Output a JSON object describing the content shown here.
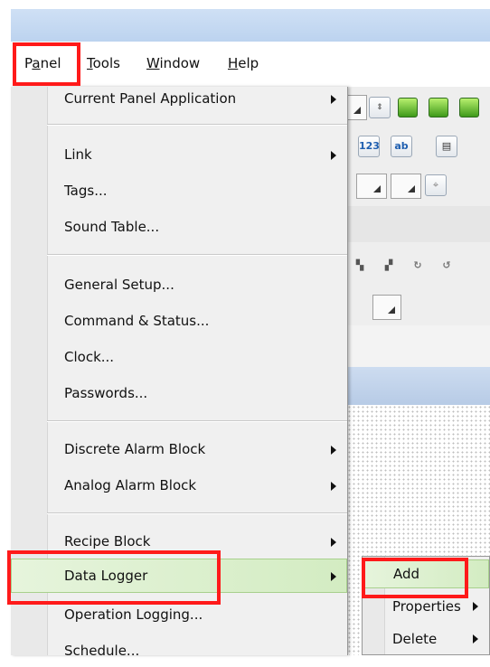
{
  "menubar": {
    "items": [
      {
        "label": "Panel",
        "accel": "a"
      },
      {
        "label": "Tools",
        "accel": "T"
      },
      {
        "label": "Window",
        "accel": "W"
      },
      {
        "label": "Help",
        "accel": "H"
      }
    ]
  },
  "panel_menu": {
    "items": [
      {
        "label": "Current Panel Application",
        "submenu": true
      },
      {
        "label": "Link",
        "submenu": true
      },
      {
        "label": "Tags...",
        "submenu": false
      },
      {
        "label": "Sound Table...",
        "submenu": false
      },
      {
        "label": "General Setup...",
        "submenu": false
      },
      {
        "label": "Command & Status...",
        "submenu": false
      },
      {
        "label": "Clock...",
        "submenu": false
      },
      {
        "label": "Passwords...",
        "submenu": false
      },
      {
        "label": "Discrete Alarm Block",
        "submenu": true
      },
      {
        "label": "Analog Alarm Block",
        "submenu": true
      },
      {
        "label": "Recipe Block",
        "submenu": true
      },
      {
        "label": "Data Logger",
        "submenu": true,
        "highlighted": true
      },
      {
        "label": "Operation Logging...",
        "submenu": false
      },
      {
        "label": "Schedule...",
        "submenu": false
      }
    ]
  },
  "data_logger_submenu": {
    "items": [
      {
        "label": "Add",
        "submenu": false,
        "highlighted": true
      },
      {
        "label": "Properties",
        "submenu": true
      },
      {
        "label": "Delete",
        "submenu": true
      }
    ]
  },
  "toolbar": {
    "btn_123": "123",
    "btn_ab": "ab"
  },
  "colors": {
    "highlight_box": "#ff1a1a",
    "menu_background": "#f0f0f0",
    "hover_green": "#d3ecc2",
    "title_blue": "#bcd3ef"
  }
}
